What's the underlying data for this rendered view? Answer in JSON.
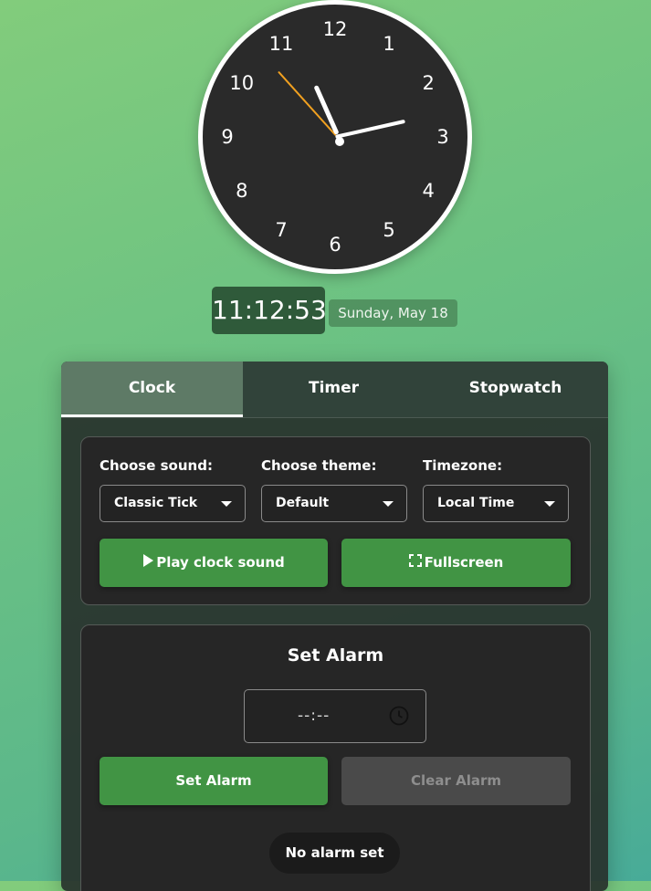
{
  "clock": {
    "numbers": [
      "12",
      "1",
      "2",
      "3",
      "4",
      "5",
      "6",
      "7",
      "8",
      "9",
      "10",
      "11"
    ],
    "hands": {
      "hour": 11,
      "minute": 12,
      "second": 53
    },
    "second_hand_color": "#f0a020"
  },
  "digital": {
    "time": "11:12:53",
    "date": "Sunday, May 18"
  },
  "tabs": [
    {
      "label": "Clock",
      "active": true
    },
    {
      "label": "Timer",
      "active": false
    },
    {
      "label": "Stopwatch",
      "active": false
    }
  ],
  "settings": {
    "sound_label": "Choose sound:",
    "sound_value": "Classic Tick",
    "theme_label": "Choose theme:",
    "theme_value": "Default",
    "timezone_label": "Timezone:",
    "timezone_value": "Local Time",
    "play_label": "Play clock sound",
    "fullscreen_label": "Fullscreen"
  },
  "alarm": {
    "title": "Set Alarm",
    "time_placeholder": "--:--",
    "set_label": "Set Alarm",
    "clear_label": "Clear Alarm",
    "status": "No alarm set"
  },
  "colors": {
    "accent_green": "#419444",
    "panel": "#262626",
    "tab_active": "#5e7a66"
  }
}
